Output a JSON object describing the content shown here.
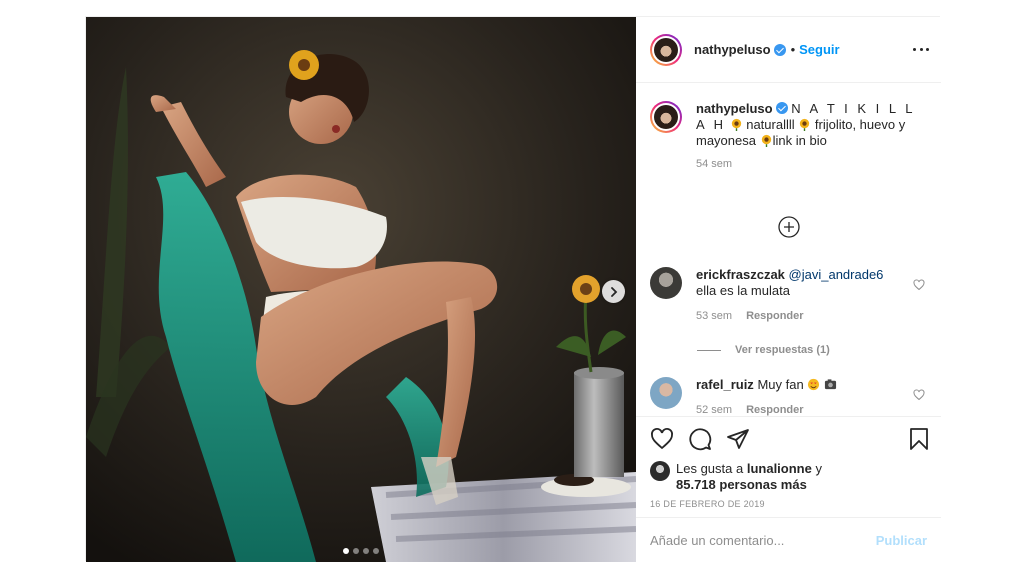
{
  "post": {
    "author": "nathypeluso",
    "follow_label": "Seguir",
    "separator": "•",
    "more_icon": "more-horizontal-icon"
  },
  "photo": {
    "alt_subject": "dancer-photo",
    "slide_dots": 4,
    "active_dot": 0,
    "next_icon": "chevron-right-icon"
  },
  "caption": {
    "username": "nathypeluso",
    "text_1": "N A T I K I L L A H",
    "text_2": "naturallll",
    "text_3": "frijolito, huevo y",
    "text_4": "mayonesa",
    "text_5": "link in bio",
    "time": "54 sem",
    "emoji_icon": "sunflower-emoji"
  },
  "load_more_icon": "plus-circle-icon",
  "comments": [
    {
      "username": "erickfraszczak",
      "mention": "@javi_andrade6",
      "text": "ella es la mulata",
      "time": "53 sem",
      "reply_label": "Responder"
    },
    {
      "username": "rafel_ruiz",
      "text": "Muy fan",
      "time": "52 sem",
      "reply_label": "Responder"
    }
  ],
  "view_replies": "Ver respuestas (1)",
  "actions": {
    "like_icon": "heart-icon",
    "comment_icon": "comment-icon",
    "share_icon": "share-icon",
    "save_icon": "bookmark-icon"
  },
  "likes": {
    "prefix": "Les gusta a",
    "user": "lunalionne",
    "conj": "y",
    "others": "85.718 personas más"
  },
  "date": "16 DE FEBRERO DE 2019",
  "add_comment": {
    "placeholder": "Añade un comentario...",
    "publish_label": "Publicar"
  },
  "colors": {
    "link_blue": "#0095f6",
    "publish_disabled": "#b2dffc",
    "muted": "#8e8e8e",
    "verified": "#3897f0"
  }
}
